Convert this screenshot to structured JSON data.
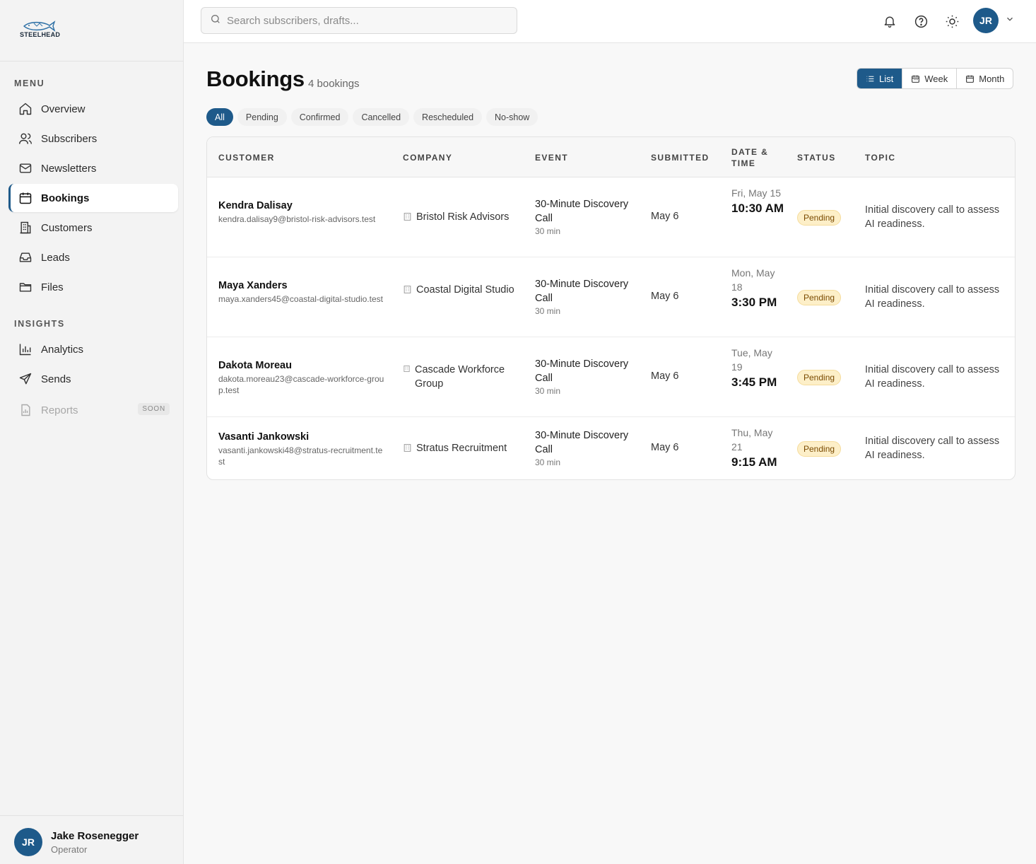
{
  "brand": {
    "logo_text": "STEELHEAD"
  },
  "sidebar": {
    "menu_label": "MENU",
    "insights_label": "INSIGHTS",
    "items": [
      {
        "label": "Overview"
      },
      {
        "label": "Subscribers"
      },
      {
        "label": "Newsletters"
      },
      {
        "label": "Bookings"
      },
      {
        "label": "Customers"
      },
      {
        "label": "Leads"
      },
      {
        "label": "Files"
      }
    ],
    "insights": [
      {
        "label": "Analytics"
      },
      {
        "label": "Sends"
      },
      {
        "label": "Reports",
        "badge": "SOON"
      }
    ],
    "user": {
      "initials": "JR",
      "name": "Jake Rosenegger",
      "role": "Operator"
    }
  },
  "topbar": {
    "search_placeholder": "Search subscribers, drafts...",
    "avatar_initials": "JR"
  },
  "page": {
    "title": "Bookings",
    "count": "4 bookings",
    "views": [
      "List",
      "Week",
      "Month"
    ],
    "active_view": "List",
    "filters": [
      "All",
      "Pending",
      "Confirmed",
      "Cancelled",
      "Rescheduled",
      "No-show"
    ],
    "active_filter": "All"
  },
  "table": {
    "headers": {
      "customer": "CUSTOMER",
      "company": "COMPANY",
      "event": "EVENT",
      "submitted": "SUBMITTED",
      "datetime_1": "DATE &",
      "datetime_2": "TIME",
      "status": "STATUS",
      "topic": "TOPIC"
    },
    "rows": [
      {
        "name": "Kendra Dalisay",
        "email": "kendra.dalisay9@bristol-risk-advisors.test",
        "company": "Bristol Risk Advisors",
        "event": "30-Minute Discovery Call",
        "duration": "30 min",
        "submitted": "May 6",
        "date": "Fri, May 15",
        "time": "10:30 AM",
        "status": "Pending",
        "topic": "Initial discovery call to assess AI readiness."
      },
      {
        "name": "Maya Xanders",
        "email": "maya.xanders45@coastal-digital-studio.test",
        "company": "Coastal Digital Studio",
        "event": "30-Minute Discovery Call",
        "duration": "30 min",
        "submitted": "May 6",
        "date": "Mon, May 18",
        "time": "3:30 PM",
        "status": "Pending",
        "topic": "Initial discovery call to assess AI readiness."
      },
      {
        "name": "Dakota Moreau",
        "email": "dakota.moreau23@cascade-workforce-group.test",
        "company": "Cascade Workforce Group",
        "event": "30-Minute Discovery Call",
        "duration": "30 min",
        "submitted": "May 6",
        "date": "Tue, May 19",
        "time": "3:45 PM",
        "status": "Pending",
        "topic": "Initial discovery call to assess AI readiness."
      },
      {
        "name": "Vasanti Jankowski",
        "email": "vasanti.jankowski48@stratus-recruitment.test",
        "company": "Stratus Recruitment",
        "event": "30-Minute Discovery Call",
        "duration": "30 min",
        "submitted": "May 6",
        "date": "Thu, May 21",
        "time": "9:15 AM",
        "status": "Pending",
        "topic": "Initial discovery call to assess AI readiness."
      }
    ]
  },
  "colors": {
    "accent": "#1e5a8a",
    "pending_bg": "#fdefc8",
    "pending_text": "#7a4a00"
  }
}
